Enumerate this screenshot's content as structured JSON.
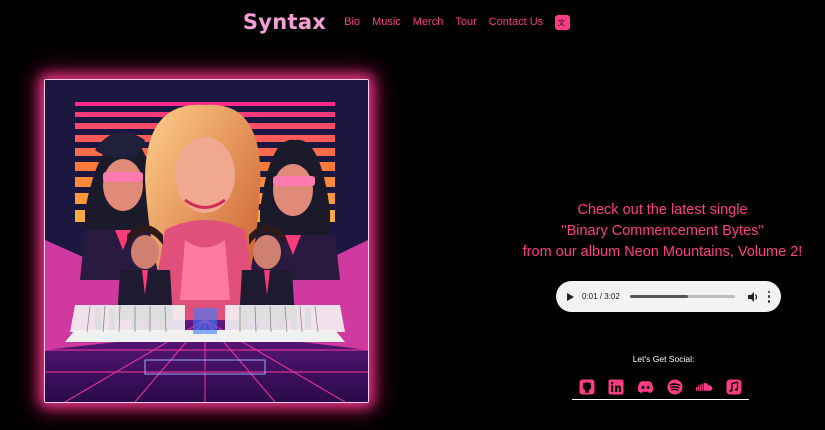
{
  "nav": {
    "brand": "Syntax",
    "links": [
      "Bio",
      "Music",
      "Merch",
      "Tour",
      "Contact Us"
    ],
    "language_icon": "translate-icon"
  },
  "album_art": {
    "icon": "album-cover-art"
  },
  "promo": {
    "line1": "Check out the latest single",
    "line2": "\"Binary Commencement Bytes\"",
    "line3": "from our album Neon Mountains, Volume 2!"
  },
  "player": {
    "time": "0:01 / 3:02",
    "progress_fraction": 0.55,
    "icons": [
      "play-icon",
      "volume-icon",
      "more-options-icon"
    ]
  },
  "social": {
    "title": "Let's Get Social:",
    "icons": [
      "github-icon",
      "linkedin-icon",
      "discord-icon",
      "spotify-icon",
      "soundcloud-icon",
      "apple-music-icon"
    ]
  },
  "colors": {
    "accent": "#ff3d86",
    "brand": "#f4a0d6",
    "background": "#000000"
  }
}
